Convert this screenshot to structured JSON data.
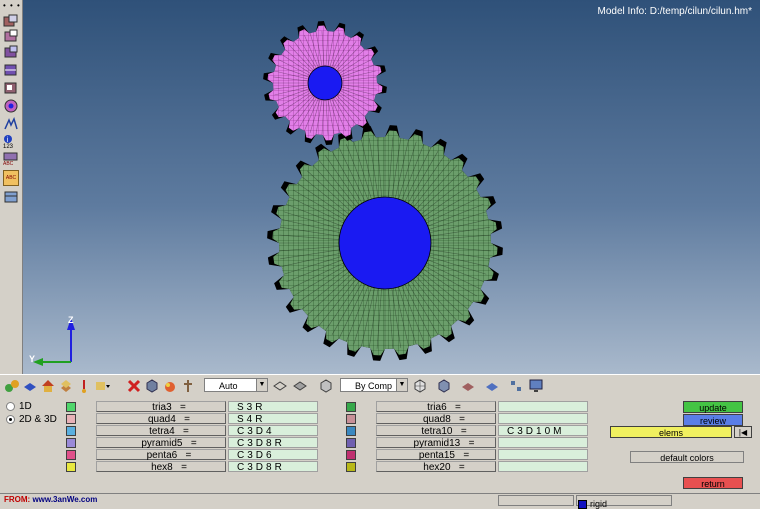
{
  "viewport": {
    "model_info": "Model Info: D:/temp/cilun/cilun.hm*",
    "axis": {
      "z": "Z",
      "y": "Y"
    },
    "colors": {
      "small_gear": "#e27fe8",
      "large_gear": "#6b9e6b",
      "hub": "#1a1af2",
      "teeth_tip": "#000000"
    }
  },
  "left_toolbar": {
    "dots": "• • •",
    "icons": [
      "display-icon",
      "mask-icon",
      "unmask-icon",
      "reverse-icon",
      "find-icon",
      "numbers-icon",
      "info-icon",
      "label-icon",
      "abc-label-icon",
      "abc-active-icon",
      "panel-icon"
    ],
    "badge_123": "123",
    "badge_abc": "ABC"
  },
  "bottom_toolbar": {
    "auto_select": "Auto",
    "bycomp_select": "By Comp"
  },
  "panel": {
    "radio_1d": "1D",
    "radio_2d3d": "2D & 3D",
    "left_rows": [
      {
        "name": "tria3",
        "eq": "=",
        "value": "S3R",
        "color": "#4fd66b"
      },
      {
        "name": "quad4",
        "eq": "=",
        "value": "S4R",
        "color": "#e8b2b8"
      },
      {
        "name": "tetra4",
        "eq": "=",
        "value": "C3D4",
        "color": "#5ab0e0"
      },
      {
        "name": "pyramid5",
        "eq": "=",
        "value": "C3D8R",
        "color": "#9a8ad8"
      },
      {
        "name": "penta6",
        "eq": "=",
        "value": "C3D6",
        "color": "#e0508a"
      },
      {
        "name": "hex8",
        "eq": "=",
        "value": "C3D8R",
        "color": "#e8e840"
      }
    ],
    "right_rows": [
      {
        "name": "tria6",
        "eq": "=",
        "value": "",
        "color": "#36a84a"
      },
      {
        "name": "quad8",
        "eq": "=",
        "value": "",
        "color": "#c89098"
      },
      {
        "name": "tetra10",
        "eq": "=",
        "value": "C3D10M",
        "color": "#3a88c0"
      },
      {
        "name": "pyramid13",
        "eq": "=",
        "value": "",
        "color": "#7060b0"
      },
      {
        "name": "penta15",
        "eq": "=",
        "value": "",
        "color": "#c03070"
      },
      {
        "name": "hex20",
        "eq": "=",
        "value": "",
        "color": "#b8b818"
      }
    ],
    "update_button": "update",
    "review_button": "review",
    "elems_selector": "elems",
    "default_colors_button": "default colors",
    "return_button": "return",
    "button_colors": {
      "update": "#44c444",
      "review": "#5a7ee6",
      "elems": "#f0f060",
      "return": "#e85050"
    }
  },
  "status_bar": {
    "from_label": "FROM:",
    "from_site": "www.3anWe.com",
    "component": "rigid"
  }
}
